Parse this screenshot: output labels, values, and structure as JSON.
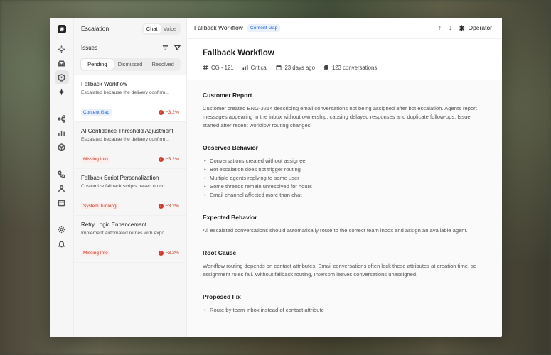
{
  "rail": {
    "icons": [
      "logo-icon",
      "settings-sun-icon",
      "inbox-icon",
      "shield-icon",
      "sparkle-icon",
      "flow-icon",
      "chart-icon",
      "box-icon",
      "phone-icon",
      "user-icon",
      "calendar-icon",
      "gear-icon",
      "bell-icon"
    ]
  },
  "issues_panel": {
    "title": "Escalation",
    "modes": [
      "Chat",
      "Voice"
    ],
    "header": "Issues",
    "tabs": [
      "Pending",
      "Dismissed",
      "Resolved"
    ],
    "items": [
      {
        "name": "Fallback Workflow",
        "desc": "Escalated because the delivery confirm...",
        "tag": "Content Gap",
        "tag_color": "blue",
        "delta": "−3.2%"
      },
      {
        "name": "AI Confidence Threshold Adjustment",
        "desc": "Escalated because the delivery confirm...",
        "tag": "Missing Info",
        "tag_color": "red",
        "delta": "−3.2%"
      },
      {
        "name": "Fallback Script Personalization",
        "desc": "Customize fallback scripts based on cu...",
        "tag": "System Tunning",
        "tag_color": "red",
        "delta": "−3.2%"
      },
      {
        "name": "Retry Logic Enhancement",
        "desc": "Implement automated retries with expo...",
        "tag": "Missing Info",
        "tag_color": "red",
        "delta": "−3.2%"
      }
    ]
  },
  "topbar": {
    "title": "Fallback Workflow",
    "badge": "Content Gap",
    "operator": "Operator"
  },
  "header": {
    "title": "Fallback Workflow",
    "id": "CG - 121",
    "severity": "Critical",
    "age": "23 days ago",
    "conversations": "123 conversations"
  },
  "sections": {
    "customer_report": {
      "title": "Customer Report",
      "text": "Customer created ENG-3214 describing email conversations not being assigned after bot escalation. Agents report messages appearing in the inbox without ownership, causing delayed responses and duplicate follow-ups. Issue started after recent workflow routing changes."
    },
    "observed": {
      "title": "Observed Behavior",
      "items": [
        "Conversations created without assignee",
        "Bot escalation does not trigger routing",
        "Multiple agents replying to same user",
        "Some threads remain unresolved for hours",
        "Email channel affected more than chat"
      ]
    },
    "expected": {
      "title": "Expected Behavior",
      "text": "All escalated conversations should automatically route to the correct team inbox and assign an available agent."
    },
    "root_cause": {
      "title": "Root Cause",
      "text": "Workflow routing depends on contact attributes. Email conversations often lack these attributes at creation time, so assignment rules fail. Without fallback routing, Intercom leaves conversations unassigned."
    },
    "proposed": {
      "title": "Proposed Fix",
      "items": [
        "Route by team inbox instead of contact attribute"
      ]
    }
  }
}
